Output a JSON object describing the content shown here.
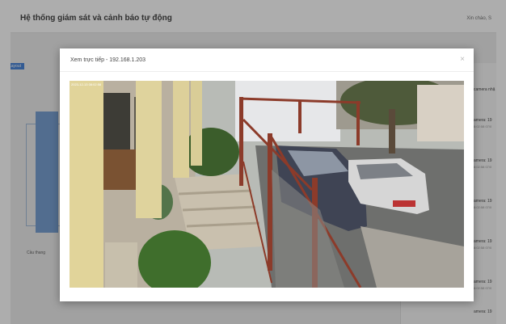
{
  "app": {
    "title": "Hệ thống giám sát và cảnh báo tự động",
    "greeting": "Xin chào, S",
    "layout_button": "Layout",
    "diagram_caption": "Cầu thang"
  },
  "side_list": [
    {
      "label": "camera nhậ",
      "sub": ""
    },
    {
      "label": "amera: 19",
      "sub": "8:02:58 07/0"
    },
    {
      "label": "amera: 19",
      "sub": "8:02:58 07/0"
    },
    {
      "label": "amera: 19",
      "sub": "8:02:58 07/0"
    },
    {
      "label": "amera: 19",
      "sub": "8:02:58 07/0"
    },
    {
      "label": "amera: 19",
      "sub": "8:02:58 07/0"
    },
    {
      "label": "amera: 19",
      "sub": "8:02:58 07/0"
    }
  ],
  "modal": {
    "title": "Xem trực tiếp - 192.168.1.203",
    "close_symbol": "×",
    "timestamp": "2023-12-13 08:02:58"
  },
  "colors": {
    "overlay": "#282828",
    "accent": "#3a7bd5",
    "fence": "#8c3b2a"
  }
}
